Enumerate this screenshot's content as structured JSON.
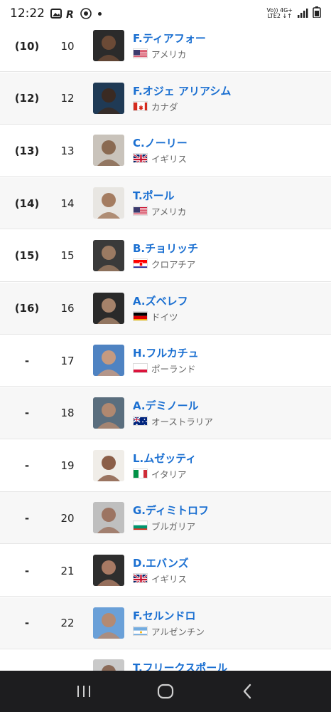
{
  "status_bar": {
    "time": "12:22",
    "network_top": "Vo)) 4G+",
    "network_bottom": "LTE2 ↓↑",
    "icons": [
      "gallery-icon",
      "app-r-icon",
      "tennis-icon",
      "notification-dot-icon",
      "signal-icon",
      "battery-icon"
    ]
  },
  "rankings": [
    {
      "prev": "(10)",
      "rank": "10",
      "name": "F.ティアフォー",
      "country": "アメリカ",
      "flag": "us"
    },
    {
      "prev": "(12)",
      "rank": "12",
      "name": "F.オジェ アリアシム",
      "country": "カナダ",
      "flag": "ca"
    },
    {
      "prev": "(13)",
      "rank": "13",
      "name": "C.ノーリー",
      "country": "イギリス",
      "flag": "gb"
    },
    {
      "prev": "(14)",
      "rank": "14",
      "name": "T.ポール",
      "country": "アメリカ",
      "flag": "us"
    },
    {
      "prev": "(15)",
      "rank": "15",
      "name": "B.チョリッチ",
      "country": "クロアチア",
      "flag": "hr"
    },
    {
      "prev": "(16)",
      "rank": "16",
      "name": "A.ズベレフ",
      "country": "ドイツ",
      "flag": "de"
    },
    {
      "prev": "-",
      "rank": "17",
      "name": "H.フルカチュ",
      "country": "ポーランド",
      "flag": "pl"
    },
    {
      "prev": "-",
      "rank": "18",
      "name": "A.デミノール",
      "country": "オーストラリア",
      "flag": "au"
    },
    {
      "prev": "-",
      "rank": "19",
      "name": "L.ムゼッティ",
      "country": "イタリア",
      "flag": "it"
    },
    {
      "prev": "-",
      "rank": "20",
      "name": "G.ディミトロフ",
      "country": "ブルガリア",
      "flag": "bg"
    },
    {
      "prev": "-",
      "rank": "21",
      "name": "D.エバンズ",
      "country": "イギリス",
      "flag": "gb"
    },
    {
      "prev": "-",
      "rank": "22",
      "name": "F.セルンドロ",
      "country": "アルゼンチン",
      "flag": "ar"
    },
    {
      "prev": "",
      "rank": "",
      "name": "T.フリークスポール",
      "country": "",
      "flag": ""
    }
  ],
  "nav_bar": {
    "buttons": [
      "recents-icon",
      "home-icon",
      "back-icon"
    ]
  }
}
